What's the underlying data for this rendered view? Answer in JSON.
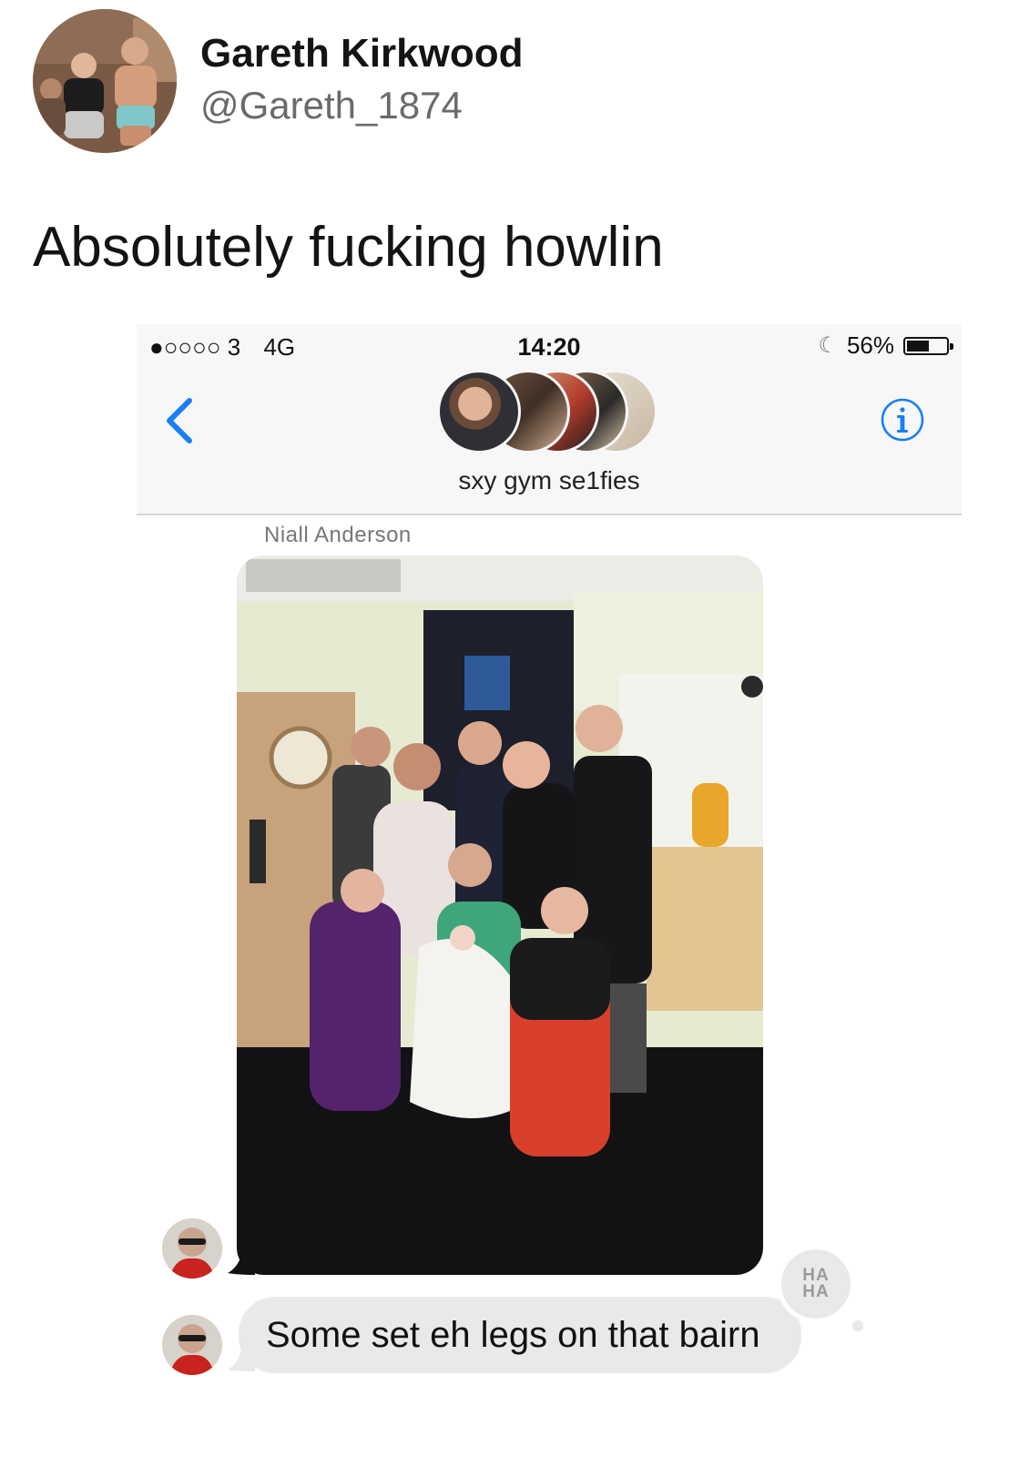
{
  "tweet": {
    "author_name": "Gareth Kirkwood",
    "author_handle": "@Gareth_1874",
    "text": "Absolutely fucking howlin"
  },
  "phone": {
    "status_bar": {
      "signal": "●○○○○ 3",
      "network": "4G",
      "time": "14:20",
      "battery_percent": "56%",
      "battery_level": 0.56
    },
    "conversation": {
      "group_name": "sxy gym se1fies"
    },
    "messages": [
      {
        "sender": "Niall Anderson",
        "kind": "photo"
      },
      {
        "kind": "text",
        "text": "Some set eh legs on that bairn"
      }
    ],
    "reaction": {
      "line1": "HA",
      "line2": "HA"
    },
    "icons": {
      "back": "chevron-left-icon",
      "info": "info-icon",
      "do_not_disturb": "moon-icon"
    },
    "colors": {
      "accent": "#1a7ef5",
      "incoming_bubble": "#e9e9eb"
    }
  }
}
